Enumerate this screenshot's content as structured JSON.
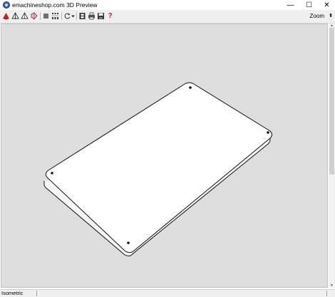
{
  "window": {
    "title": "emachineshop.com 3D Preview",
    "controls": {
      "minimize": "—",
      "maximize": "☐",
      "close": "✕"
    }
  },
  "toolbar": {
    "tools": [
      {
        "name": "red-shape-icon",
        "color": "#cc1f1f"
      },
      {
        "name": "wireframe-icon"
      },
      {
        "name": "shaded-icon"
      },
      {
        "name": "color-shape-icon"
      },
      {
        "name": "square-icon"
      },
      {
        "name": "numbers-icon"
      },
      {
        "name": "rotate-icon"
      },
      {
        "name": "dropdown-arrow-icon"
      },
      {
        "name": "film-icon"
      },
      {
        "name": "print-icon"
      },
      {
        "name": "save-icon"
      },
      {
        "name": "help-icon",
        "color": "#cc1f1f"
      }
    ],
    "zoom_label": "Zoom",
    "zoom_caret": "⬍"
  },
  "viewport": {
    "background": "#dedede",
    "part": "flat rectangular plate with four corner holes"
  },
  "status": {
    "view_mode": "Isometric"
  }
}
